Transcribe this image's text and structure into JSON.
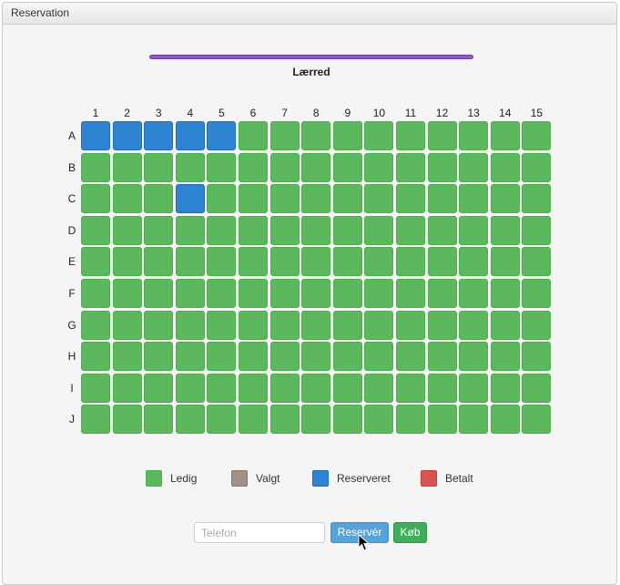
{
  "panel": {
    "title": "Reservation"
  },
  "screen": {
    "label": "Lærred"
  },
  "seating": {
    "columns": [
      "1",
      "2",
      "3",
      "4",
      "5",
      "6",
      "7",
      "8",
      "9",
      "10",
      "11",
      "12",
      "13",
      "14",
      "15"
    ],
    "rows": [
      "A",
      "B",
      "C",
      "D",
      "E",
      "F",
      "G",
      "H",
      "I",
      "J"
    ],
    "reserved": [
      [
        "A",
        "1"
      ],
      [
        "A",
        "2"
      ],
      [
        "A",
        "3"
      ],
      [
        "A",
        "4"
      ],
      [
        "A",
        "5"
      ],
      [
        "C",
        "4"
      ]
    ],
    "selected": [],
    "paid": []
  },
  "legend": [
    {
      "label": "Ledig",
      "color": "#5cb85c",
      "icon": "available-swatch"
    },
    {
      "label": "Valgt",
      "color": "#a39087",
      "icon": "selected-swatch"
    },
    {
      "label": "Reserveret",
      "color": "#2f84d2",
      "icon": "reserved-swatch"
    },
    {
      "label": "Betalt",
      "color": "#d9534f",
      "icon": "paid-swatch"
    }
  ],
  "form": {
    "phone_placeholder": "Telefon",
    "phone_value": "",
    "reserve_label": "Reservér",
    "buy_label": "Køb"
  }
}
